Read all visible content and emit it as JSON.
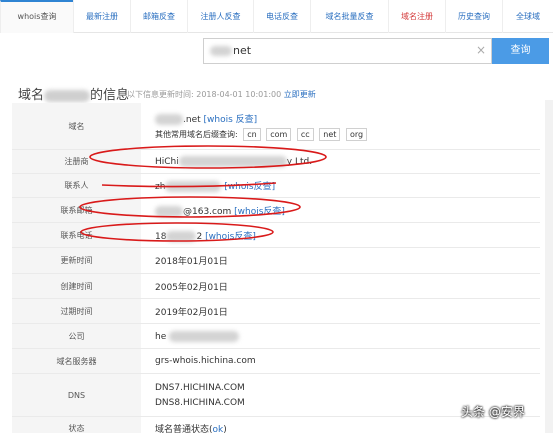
{
  "tabs": [
    {
      "label": "whois查询",
      "active": true
    },
    {
      "label": "最新注册"
    },
    {
      "label": "邮箱反查"
    },
    {
      "label": "注册人反查"
    },
    {
      "label": "电话反查"
    },
    {
      "label": "域名批量反查"
    },
    {
      "label": "域名注册",
      "red": true
    },
    {
      "label": "历史查询"
    },
    {
      "label": "全球域"
    }
  ],
  "search": {
    "value": "net",
    "clear": "×",
    "button": "查询"
  },
  "section": {
    "title_prefix": "域名",
    "title_suffix": "的信息",
    "note": "以下信息更新时间: 2018-04-01 10:01:00",
    "update_link": "立即更新"
  },
  "rows": {
    "domain": {
      "key": "域名",
      "value": ".net",
      "link": "[whois 反查]",
      "suffix_label": "其他常用域名后缀查询:",
      "suffixes": [
        "cn",
        "com",
        "cc",
        "net",
        "org"
      ]
    },
    "registrar": {
      "key": "注册商",
      "value": "HiChi",
      "value_tail": "y Ltd."
    },
    "contact": {
      "key": "联系人",
      "value": "zh",
      "link": "[whois反查]"
    },
    "email": {
      "key": "联系邮箱",
      "value": "@163.com",
      "link": "[whois反查]"
    },
    "phone": {
      "key": "联系电话",
      "value": "18",
      "value_tail": "2",
      "link": "[whois反查]"
    },
    "updated": {
      "key": "更新时间",
      "value": "2018年01月01日"
    },
    "created": {
      "key": "创建时间",
      "value": "2005年02月01日"
    },
    "expires": {
      "key": "过期时间",
      "value": "2019年02月01日"
    },
    "company": {
      "key": "公司",
      "value": "he"
    },
    "whois_server": {
      "key": "域名服务器",
      "value": "grs-whois.hichina.com"
    },
    "dns": {
      "key": "DNS",
      "value1": "DNS7.HICHINA.COM",
      "value2": "DNS8.HICHINA.COM"
    },
    "status": {
      "key": "状态",
      "value": "域名普通状态(",
      "link": "ok",
      "value_end": ")"
    }
  },
  "watermark": "头条 @安界",
  "colors": {
    "accent": "#4b9be6",
    "link": "#2a6fc0",
    "annotation": "#d91a1a",
    "key_bg": "#f5f5f5"
  }
}
